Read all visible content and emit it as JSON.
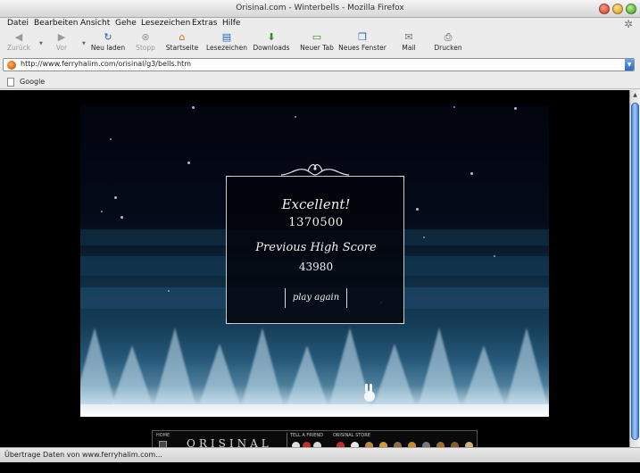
{
  "window": {
    "title": "Orisinal.com - Winterbells - Mozilla Firefox"
  },
  "menu": [
    "Datei",
    "Bearbeiten",
    "Ansicht",
    "Gehe",
    "Lesezeichen",
    "Extras",
    "Hilfe"
  ],
  "toolbar": {
    "back": "Zurück",
    "forward": "Vor",
    "reload": "Neu laden",
    "stop": "Stopp",
    "home": "Startseite",
    "bookmarks": "Lesezeichen",
    "downloads": "Downloads",
    "new_tab": "Neuer Tab",
    "new_window": "Neues Fenster",
    "mail": "Mail",
    "print": "Drucken"
  },
  "url": "http://www.ferryhalim.com/orisinal/g3/bells.htm",
  "bookmarks": [
    "Google"
  ],
  "game": {
    "headline": "Excellent!",
    "score": "1370500",
    "previous_label": "Previous High Score",
    "previous_score": "43980",
    "play_again": "play again"
  },
  "orisinal_bar": {
    "home": "HOME",
    "logo": "ORISINAL",
    "tell": "TELL A FRIEND",
    "store": "ORISINAL STORE"
  },
  "status": "Übertrage Daten von www.ferryhalim.com..."
}
